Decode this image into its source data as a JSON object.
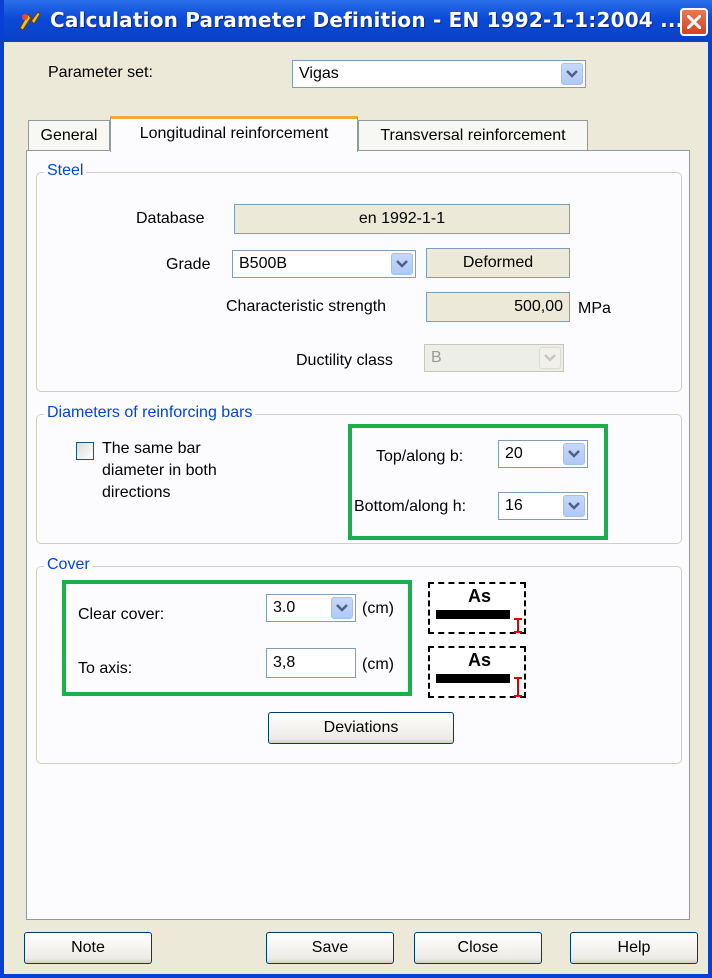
{
  "window": {
    "title": "Calculation Parameter Definition - EN 1992-1-1:2004 ..."
  },
  "parameter_set": {
    "label": "Parameter set:",
    "value": "Vigas"
  },
  "tabs": [
    {
      "label": "General"
    },
    {
      "label": "Longitudinal reinforcement"
    },
    {
      "label": "Transversal reinforcement"
    }
  ],
  "steel": {
    "title": "Steel",
    "database_label": "Database",
    "database_value": "en 1992-1-1",
    "grade_label": "Grade",
    "grade_value": "B500B",
    "surface_value": "Deformed",
    "strength_label": "Characteristic strength",
    "strength_value": "500,00",
    "strength_unit": "MPa",
    "ductility_label": "Ductility class",
    "ductility_value": "B"
  },
  "diameters": {
    "title": "Diameters of reinforcing bars",
    "same_diameter_line1": "The same bar",
    "same_diameter_line2": "diameter in both",
    "same_diameter_line3": "directions",
    "same_diameter_checked": false,
    "top_label": "Top/along b:",
    "top_value": "20",
    "bottom_label": "Bottom/along h:",
    "bottom_value": "16"
  },
  "cover": {
    "title": "Cover",
    "clear_label": "Clear cover:",
    "clear_value": "3.0",
    "clear_unit": "(cm)",
    "axis_label": "To axis:",
    "axis_value": "3,8",
    "axis_unit": "(cm)",
    "icon_text_1": "As",
    "icon_text_2": "As",
    "deviations_button": "Deviations"
  },
  "footer": {
    "note": "Note",
    "save": "Save",
    "close": "Close",
    "help": "Help"
  },
  "colors": {
    "titlebar": "#0b49d8",
    "highlight": "#19b04c",
    "group_title": "#0046d5",
    "marker": "#e00000"
  }
}
